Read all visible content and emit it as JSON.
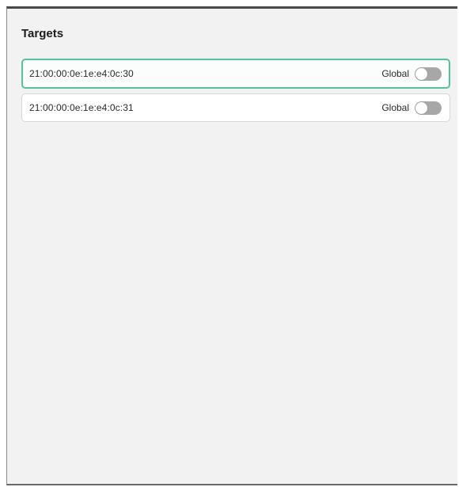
{
  "panel": {
    "title": "Targets"
  },
  "targets": [
    {
      "wwn": "21:00:00:0e:1e:e4:0c:30",
      "toggle_label": "Global",
      "global_enabled": false,
      "selected": true
    },
    {
      "wwn": "21:00:00:0e:1e:e4:0c:31",
      "toggle_label": "Global",
      "global_enabled": false,
      "selected": false
    }
  ],
  "colors": {
    "selected_border": "#56c29a",
    "toggle_off": "#a7a7a7",
    "panel_background": "#f2f2f2"
  }
}
